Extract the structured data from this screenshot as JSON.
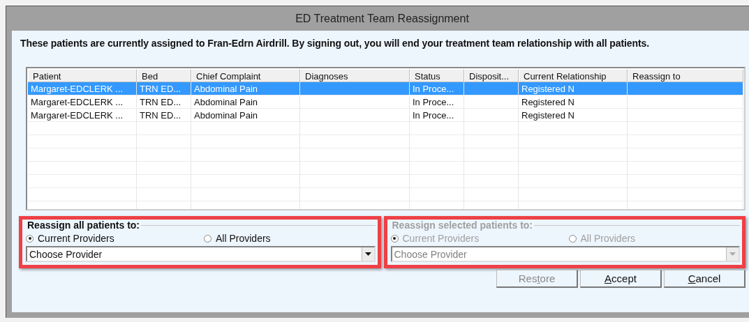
{
  "window": {
    "title": "ED Treatment Team Reassignment"
  },
  "message": "These patients are currently assigned to Fran-Edrn Airdrill. By signing out, you will end your treatment team relationship with all patients.",
  "table": {
    "columns": [
      "Patient",
      "Bed",
      "Chief Complaint",
      "Diagnoses",
      "Status",
      "Disposit...",
      "Current Relationship",
      "Reassign to"
    ],
    "rows": [
      {
        "selected": true,
        "cells": [
          "Margaret-EDCLERK ...",
          "TRN ED...",
          "Abdominal Pain",
          "",
          "In Proce...",
          "",
          "Registered N",
          ""
        ]
      },
      {
        "selected": false,
        "cells": [
          "Margaret-EDCLERK ...",
          "TRN ED...",
          "Abdominal Pain",
          "",
          "In Proce...",
          "",
          "Registered N",
          ""
        ]
      },
      {
        "selected": false,
        "cells": [
          "Margaret-EDCLERK ...",
          "TRN ED...",
          "Abdominal Pain",
          "",
          "In Proce...",
          "",
          "Registered N",
          ""
        ]
      }
    ]
  },
  "groups": [
    {
      "legend": "Reassign all patients to:",
      "disabled": false,
      "options": [
        {
          "label": "Current Providers",
          "selected": true
        },
        {
          "label": "All Providers",
          "selected": false
        }
      ],
      "dropdown": "Choose Provider"
    },
    {
      "legend": "Reassign selected patients to:",
      "disabled": true,
      "options": [
        {
          "label": "Current Providers",
          "selected": true
        },
        {
          "label": "All Providers",
          "selected": false
        }
      ],
      "dropdown": "Choose Provider"
    }
  ],
  "buttons": [
    {
      "pre": "Res",
      "key": "t",
      "post": "ore",
      "disabled": true
    },
    {
      "key": "A",
      "post": "ccept",
      "disabled": false
    },
    {
      "key": "C",
      "post": "ancel",
      "disabled": false
    }
  ]
}
